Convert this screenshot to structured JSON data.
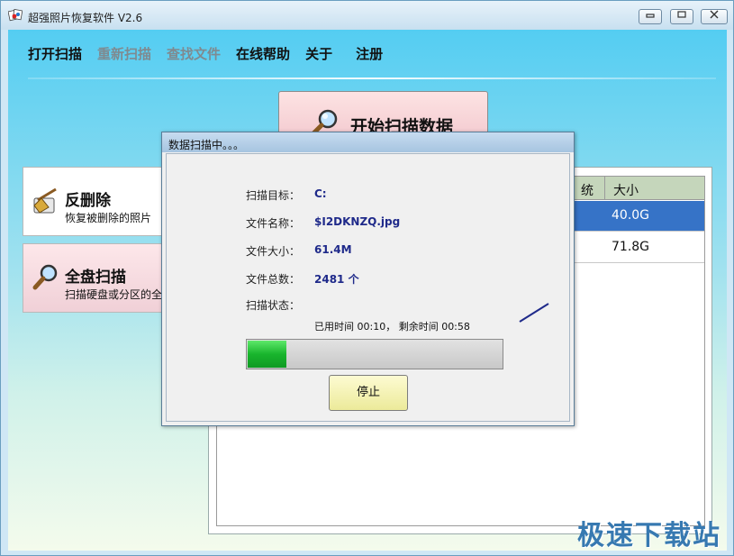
{
  "window": {
    "title": "超强照片恢复软件 V2.6",
    "min_label": "▭",
    "max_label": "▢",
    "close_label": "✕"
  },
  "menu": [
    {
      "label": "打开扫描",
      "enabled": true
    },
    {
      "label": "重新扫描",
      "enabled": false
    },
    {
      "label": "查找文件",
      "enabled": false
    },
    {
      "label": "在线帮助",
      "enabled": true
    },
    {
      "label": "关于",
      "enabled": true
    },
    {
      "label": "注册",
      "enabled": true
    }
  ],
  "start_button": {
    "label": "开始扫描数据",
    "icon": "magnifier-icon"
  },
  "side_cards": [
    {
      "title": "反删除",
      "subtitle": "恢复被删除的照片",
      "icon": "broom-icon"
    },
    {
      "title": "全盘扫描",
      "subtitle": "扫描硬盘或分区的全",
      "icon": "magnifier-icon"
    }
  ],
  "results": {
    "headers": [
      "统",
      "大小"
    ],
    "rows": [
      {
        "size": "40.0G",
        "selected": true
      },
      {
        "size": "71.8G",
        "selected": false
      }
    ]
  },
  "dialog": {
    "title": "数据扫描中。。。",
    "fields": [
      {
        "label": "扫描目标：",
        "value": "C:"
      },
      {
        "label": "文件名称：",
        "value": "$I2DKNZQ.jpg"
      },
      {
        "label": "文件大小：",
        "value": "61.4M"
      },
      {
        "label": "文件总数：",
        "value": "2481 个"
      },
      {
        "label": "扫描状态：",
        "value": ""
      }
    ],
    "time_text": "已用时间 00:10， 剩余时间 00:58",
    "progress": 0.15,
    "stop_label": "停止"
  },
  "watermark": "极速下载站",
  "colors": {
    "selected_row": "#3673c7",
    "value_text": "#1f2a8a",
    "progress": "#19b52d"
  }
}
